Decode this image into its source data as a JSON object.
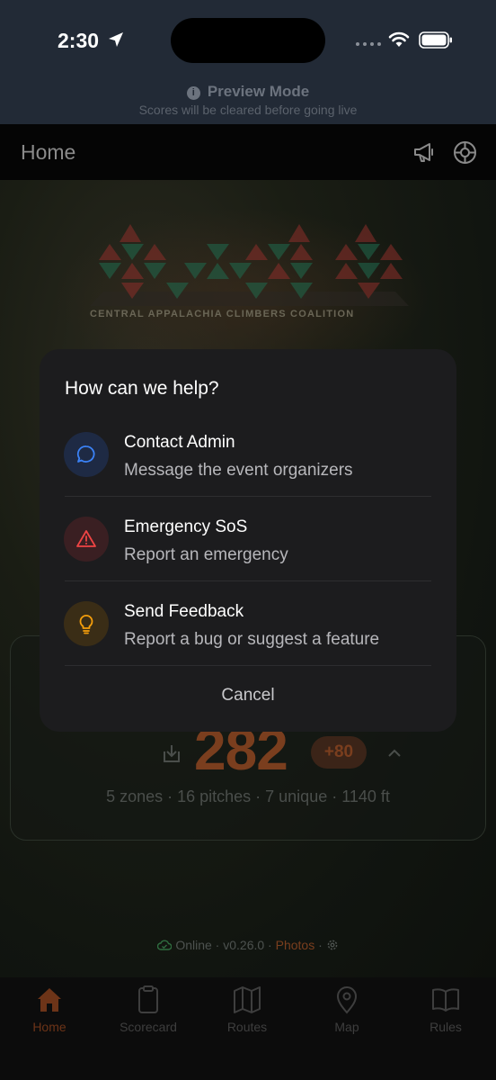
{
  "status_bar": {
    "time": "2:30",
    "icons": [
      "location-arrow-icon",
      "signal-dots-icon",
      "wifi-icon",
      "battery-icon"
    ]
  },
  "preview": {
    "title": "Preview Mode",
    "subtitle": "Scores will be cleared before going live"
  },
  "header": {
    "title": "Home",
    "icons": [
      "megaphone-icon",
      "globe-icon"
    ]
  },
  "logo": {
    "text": "CENTRAL APPALACHIA CLIMBERS COALITION",
    "colors": {
      "red": "#8c2e2a",
      "green": "#1f6a4e",
      "dark": "#2a2622"
    }
  },
  "score": {
    "value": "282",
    "delta": "+80",
    "stats": "5 zones · 16 pitches · 7 unique · 1140 ft"
  },
  "footer": {
    "online": "Online",
    "sep1": " · ",
    "version": "v0.26.0",
    "sep2": " · ",
    "photos": "Photos",
    "sep3": " · "
  },
  "dialog": {
    "title": "How can we help?",
    "options": [
      {
        "title": "Contact Admin",
        "desc": "Message the event organizers",
        "icon": "chat-bubble-icon",
        "icon_color": "#3b82f6",
        "bg_color": "#1e2a44"
      },
      {
        "title": "Emergency SoS",
        "desc": "Report an emergency",
        "icon": "warning-triangle-icon",
        "icon_color": "#ef4444",
        "bg_color": "#3a1f22"
      },
      {
        "title": "Send Feedback",
        "desc": "Report a bug or suggest a feature",
        "icon": "lightbulb-icon",
        "icon_color": "#f59e0b",
        "bg_color": "#3a2d16"
      }
    ],
    "cancel": "Cancel"
  },
  "tabs": [
    {
      "label": "Home",
      "icon": "home-icon",
      "active": true
    },
    {
      "label": "Scorecard",
      "icon": "clipboard-icon",
      "active": false
    },
    {
      "label": "Routes",
      "icon": "map-fold-icon",
      "active": false
    },
    {
      "label": "Map",
      "icon": "map-pin-icon",
      "active": false
    },
    {
      "label": "Rules",
      "icon": "book-icon",
      "active": false
    }
  ],
  "colors": {
    "accent": "#d9642a",
    "status_bg": "#222a36",
    "dialog_bg": "#1c1c1e"
  }
}
